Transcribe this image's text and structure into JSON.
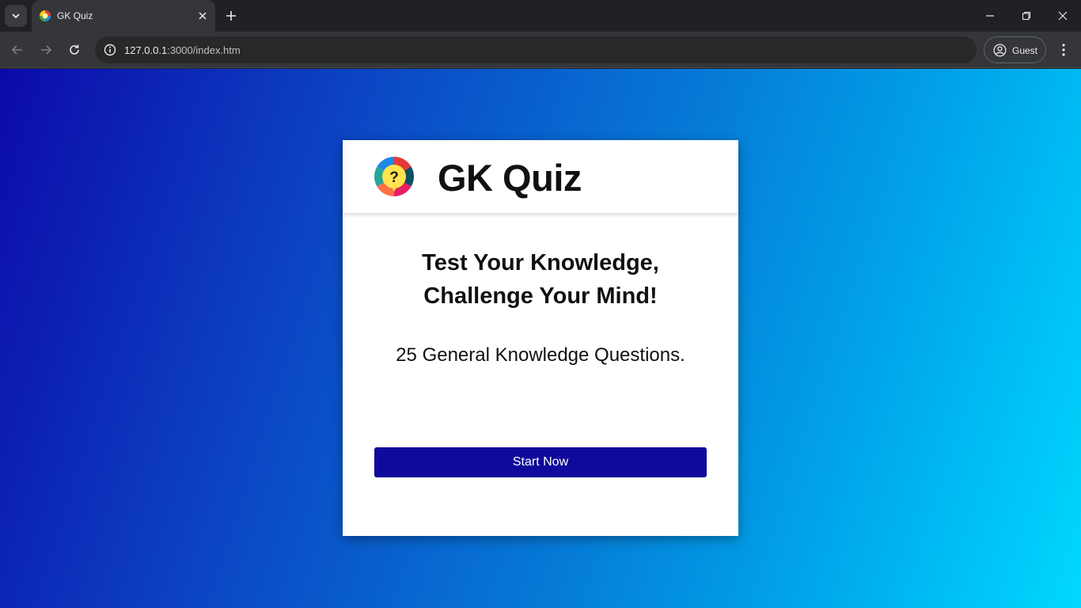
{
  "browser": {
    "tab": {
      "title": "GK Quiz"
    },
    "address": {
      "host": "127.0.0.1",
      "path": ":3000/index.htm"
    },
    "profile": {
      "label": "Guest"
    }
  },
  "page": {
    "header": {
      "title": "GK Quiz",
      "logo_icon": "question-wheel-icon"
    },
    "headline_line1": "Test Your Knowledge,",
    "headline_line2": "Challenge Your Mind!",
    "subtext": "25 General Knowledge Questions.",
    "start_button": "Start Now"
  },
  "colors": {
    "button": "#100a9c",
    "gradient_start": "#0c0aa8",
    "gradient_end": "#00d8ff"
  }
}
